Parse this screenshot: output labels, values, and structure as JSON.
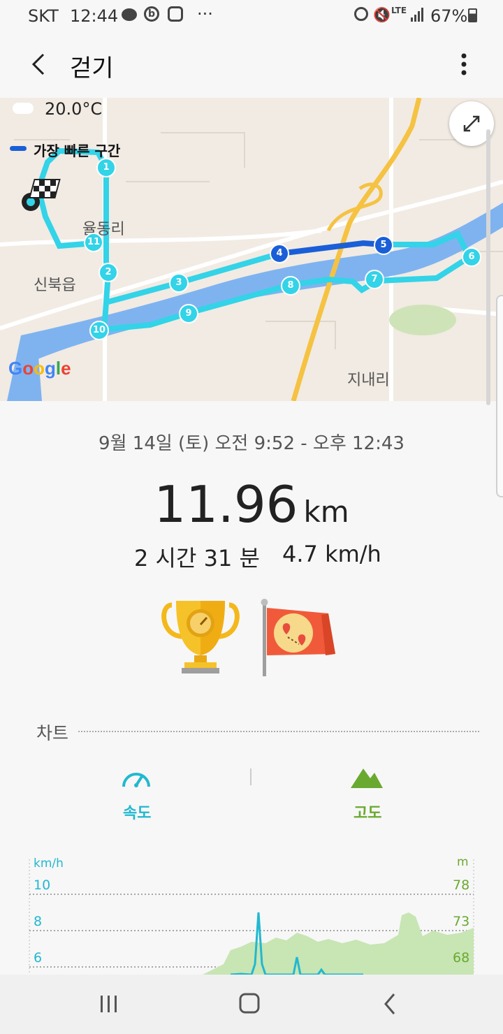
{
  "status": {
    "carrier": "SKT",
    "time": "12:44",
    "battery": "67%",
    "network": "LTE",
    "more": "···"
  },
  "app": {
    "title": "걷기"
  },
  "map": {
    "temperature": "20.0°C",
    "legend_label": "가장 빠른 구간",
    "places": [
      "율동리",
      "신북읍",
      "지내리"
    ],
    "markers": [
      "1",
      "2",
      "3",
      "4",
      "5",
      "6",
      "7",
      "8",
      "9",
      "10",
      "11"
    ],
    "google": [
      "G",
      "o",
      "o",
      "g",
      "l",
      "e"
    ],
    "colors": {
      "route": "#33d3e8",
      "fastest": "#1a5fd8"
    }
  },
  "summary": {
    "datetime": "9월 14일 (토) 오전 9:52 - 오후 12:43",
    "distance": "11.96",
    "distance_unit": "km",
    "duration": "2 시간 31 분",
    "speed": "4.7 km/h"
  },
  "chart_section": {
    "heading": "차트",
    "tabs": [
      {
        "label": "속도",
        "color": "#22b8d0"
      },
      {
        "label": "고도",
        "color": "#6aa92f"
      }
    ]
  },
  "chart_data": {
    "type": "line",
    "left_axis": {
      "unit": "km/h",
      "ticks": [
        "10",
        "8",
        "6"
      ]
    },
    "right_axis": {
      "unit": "m",
      "ticks": [
        "78",
        "73",
        "68"
      ]
    },
    "series": [
      {
        "color": "#22b8d0"
      },
      {
        "color": "#c8e5b4"
      }
    ]
  }
}
